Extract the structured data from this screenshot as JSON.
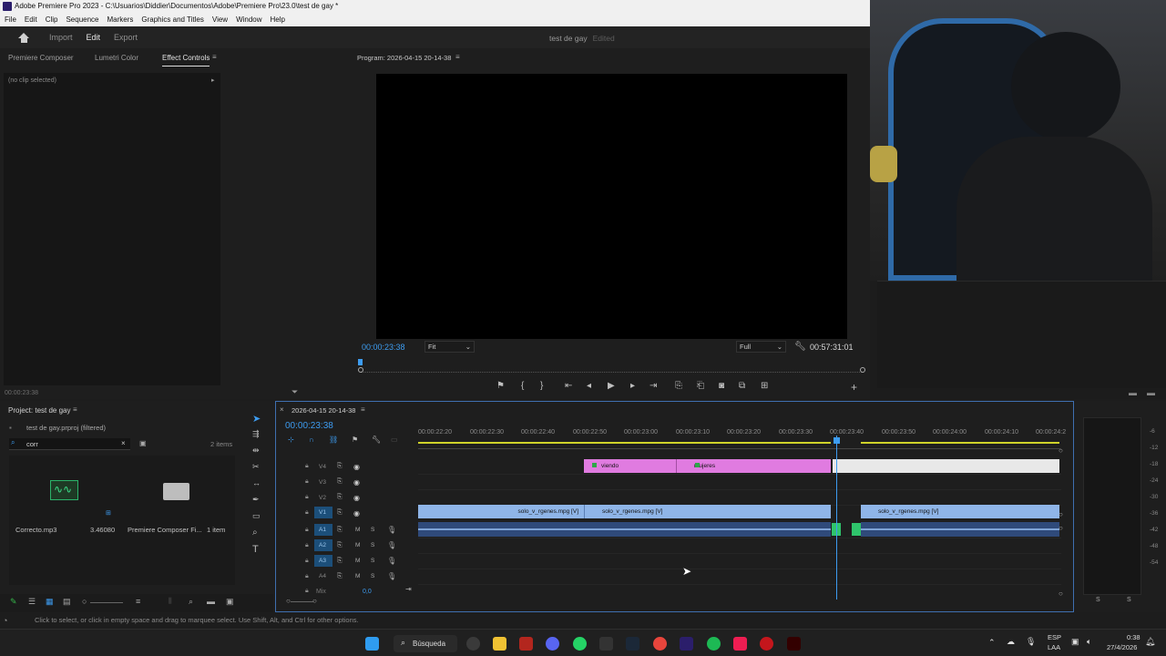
{
  "window": {
    "title": "Adobe Premiere Pro 2023 - C:\\Usuarios\\Diddier\\Documentos\\Adobe\\Premiere Pro\\23.0\\test de gay *"
  },
  "menu": [
    "File",
    "Edit",
    "Clip",
    "Sequence",
    "Markers",
    "Graphics and Titles",
    "View",
    "Window",
    "Help"
  ],
  "workspace": {
    "tabs": [
      "Import",
      "Edit",
      "Export"
    ],
    "active": "Edit",
    "doc_title": "test de gay",
    "doc_state": "Edited"
  },
  "effects": {
    "tabs": [
      "Premiere Composer",
      "Lumetri Color",
      "Effect Controls"
    ],
    "active": "Effect Controls",
    "no_clip": "(no clip selected)",
    "timecode": "00:00:23:38"
  },
  "program": {
    "title": "Program: 2026-04-15 20-14-38",
    "timecode": "00:00:23:38",
    "fit": "Fit",
    "quality": "Full",
    "duration": "00:57:31:01"
  },
  "project": {
    "title": "Project: test de gay",
    "file": "test de gay.prproj (filtered)",
    "search": "corr",
    "count": "2 items",
    "items": [
      {
        "name": "Correcto.mp3",
        "meta": "3.46080"
      },
      {
        "name": "Premiere Composer Fi...",
        "meta": "1 item"
      }
    ]
  },
  "timeline": {
    "title": "2026-04-15 20-14-38",
    "timecode": "00:00:23:38",
    "ruler": [
      "00:00:22:20",
      "00:00:22:30",
      "00:00:22:40",
      "00:00:22:50",
      "00:00:23:00",
      "00:00:23:10",
      "00:00:23:20",
      "00:00:23:30",
      "00:00:23:40",
      "00:00:23:50",
      "00:00:24:00",
      "00:00:24:10",
      "00:00:24:2"
    ],
    "video_tracks": [
      "V4",
      "V3",
      "V2",
      "V1"
    ],
    "audio_tracks": [
      "A1",
      "A2",
      "A3",
      "A4"
    ],
    "mix_label": "Mix",
    "mix_value": "0,0",
    "clips": {
      "viendo": "viendo",
      "mujeres": "mujeres",
      "v1a": "solo_v_rgenes.mpg [V]",
      "v1b": "solo_v_rgenes.mpg [V]",
      "v1c": "solo_v_rgenes.mpg [V]"
    }
  },
  "meters": {
    "scale": [
      "-6",
      "-12",
      "-18",
      "-24",
      "-30",
      "-36",
      "-42",
      "-48",
      "-54"
    ],
    "solo": [
      "S",
      "S"
    ]
  },
  "status": "Click to select, or click in empty space and drag to marquee select. Use Shift, Alt, and Ctrl for other options.",
  "taskbar": {
    "search": "Búsqueda",
    "lang": "ESP",
    "lang2": "LAA",
    "time": "0:38",
    "date": "27/4/2026"
  },
  "colors": {
    "accent": "#3d9cf0",
    "pink_clip": "#e07be0",
    "blue_clip": "#8fb5e8",
    "audio_clip": "#2f4a7a"
  }
}
